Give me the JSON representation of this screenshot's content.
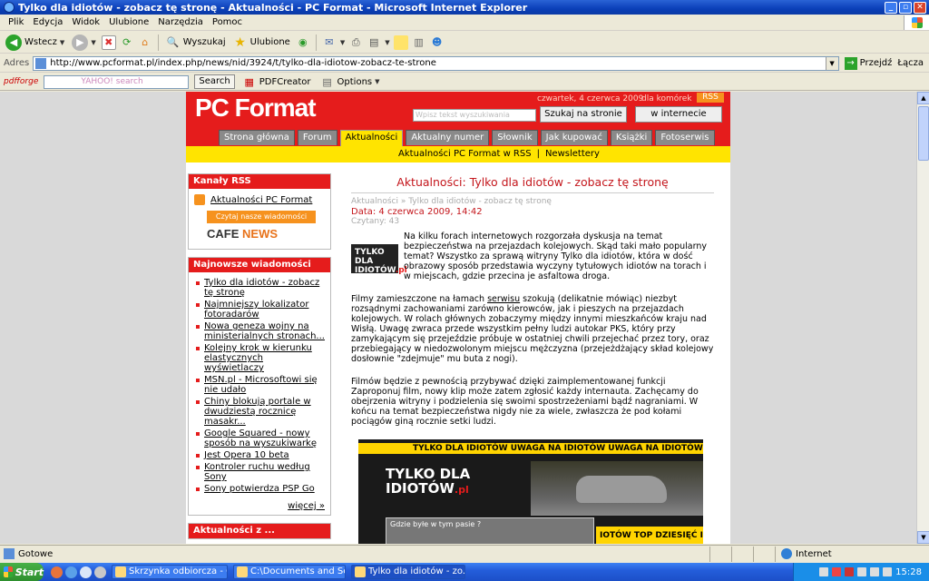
{
  "window": {
    "title": "Tylko dla idiotów - zobacz tę stronę - Aktualności - PC Format - Microsoft Internet Explorer"
  },
  "menu": [
    "Plik",
    "Edycja",
    "Widok",
    "Ulubione",
    "Narzędzia",
    "Pomoc"
  ],
  "toolbar": {
    "back_label": "Wstecz",
    "search_label": "Wyszukaj",
    "favorites_label": "Ulubione"
  },
  "address": {
    "label": "Adres",
    "url": "http://www.pcformat.pl/index.php/news/nid/3924/t/tylko-dla-idiotow-zobacz-te-strone",
    "go_label": "Przejdź",
    "links_label": "Łącza"
  },
  "searchbar": {
    "search_label": "Search",
    "pdf_creator_label": "PDFCreator",
    "options_label": "Options"
  },
  "site": {
    "logo": "PC Format",
    "date": "czwartek, 4 czerwca 2009",
    "mobile": "dla komórek",
    "rss": "RSS",
    "search_placeholder": "Wpisz tekst wyszukiwania",
    "search_site_btn": "Szukaj na stronie",
    "search_web_btn": "w internecie",
    "nav": [
      "Strona główna",
      "Forum",
      "Aktualności",
      "Aktualny numer",
      "Słownik",
      "Jak kupować",
      "Książki",
      "Fotoserwis"
    ],
    "subnav": [
      "Aktualności PC Format w RSS",
      "Newslettery"
    ]
  },
  "sidebar": {
    "rss_box": {
      "title": "Kanały RSS",
      "feed": "Aktualności PC Format",
      "read_btn": "Czytaj nasze wiadomości",
      "cafe": "CAFE",
      "cafe_news": "NEWS"
    },
    "latest": {
      "title": "Najnowsze wiadomości",
      "items": [
        "Tylko dla idiotów - zobacz tę stronę",
        "Najmniejszy lokalizator fotoradarów",
        "Nowa geneza wojny na ministerialnych stronach...",
        "Kolejny krok w kierunku elastycznych wyświetlaczy",
        "MSN.pl - Microsoftowi się nie udało",
        "Chiny blokują portale w dwudziestą rocznicę masakr...",
        "Google Squared - nowy sposób na wyszukiwarkę",
        "Jest Opera 10 beta",
        "Kontroler ruchu według Sony",
        "Sony potwierdza PSP Go"
      ],
      "more": "więcej »"
    },
    "next_box_title": "Aktualności z ..."
  },
  "article": {
    "title": "Aktualności: Tylko dla idiotów - zobacz tę stronę",
    "breadcrumb": "Aktualności » Tylko dla idiotów - zobacz tę stronę",
    "date": "Data: 4 czerwca 2009, 14:42",
    "reads": "Czytany: 43",
    "thumb_line1": "TYLKO DLA",
    "thumb_line2": "IDIOTÓW",
    "thumb_pl": ".pl",
    "intro": "Na kilku forach internetowych rozgorzała dyskusja na temat bezpieczeństwa na przejazdach kolejowych. Skąd taki mało popularny temat? Wszystko za sprawą witryny Tylko dla idiotów, która w dość obrazowy sposób przedstawia wyczyny tytułowych idiotów na torach i w miejscach, gdzie przecina je asfaltowa droga.",
    "p1_pre": "Filmy zamieszczone na łamach ",
    "p1_link": "serwisu",
    "p1_post": " szokują (delikatnie mówiąc) niezbyt rozsądnymi zachowaniami zarówno kierowców, jak i pieszych na przejazdach kolejowych. W rolach głównych zobaczymy między innymi mieszkańców kraju nad Wisłą. Uwagę zwraca przede wszystkim pełny ludzi autokar PKS, który przy zamykającym się przejeździe próbuje w ostatniej chwili przejechać przez tory, oraz przebiegający w niedozwolonym miejscu mężczyzna (przejeżdżający skład kolejowy dosłownie \"zdejmuje\" mu buta z nogi).",
    "p2": "Filmów będzie z pewnością przybywać dzięki zaimplementowanej funkcji Zaproponuj film, nowy klip może zatem zgłosić każdy internauta. Zachęcamy do obejrzenia witryny i podzielenia się swoimi spostrzeżeniami bądź nagraniami. W końcu na temat bezpieczeństwa nigdy nie za wiele, zwłaszcza że pod kołami pociągów giną rocznie setki ludzi.",
    "video": {
      "tape": "TYLKO DLA IDIOTÓW     UWAGA NA IDIOTÓW     UWAGA NA IDIOTÓW",
      "logo1": "TYLKO DLA",
      "logo2": "IDIOTÓW",
      "logo_pl": ".pl",
      "question": "Gdzie byłe w tym pasie ?",
      "top": "IOTÓW  TOP DZIESIĘĆ IDIOTÓW"
    }
  },
  "status": {
    "text": "Gotowe",
    "zone": "Internet"
  },
  "taskbar": {
    "start": "Start",
    "tasks": [
      "Skrzynka odbiorcza - Out...",
      "C:\\Documents and Settin...",
      "Tylko dla idiotów - zo..."
    ],
    "clock": "15:28"
  }
}
